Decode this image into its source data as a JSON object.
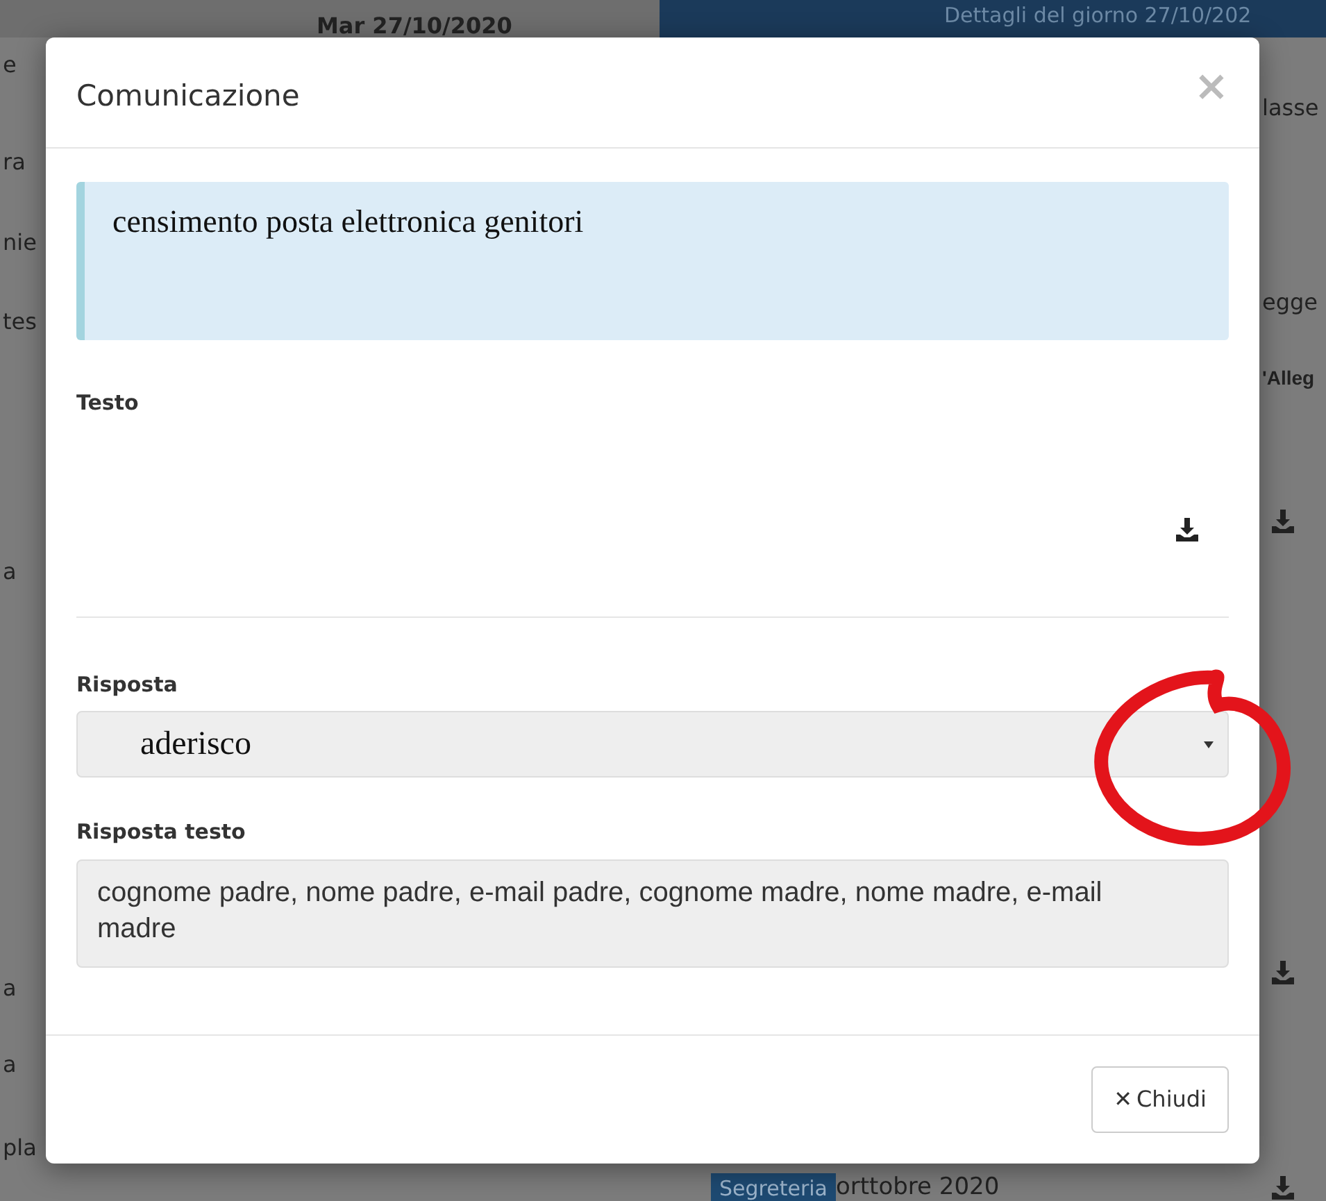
{
  "background": {
    "header_date": "Mar 27/10/2020",
    "details_bar": "Dettagli del giorno 27/10/202",
    "left_fragments": [
      "e",
      "ra",
      "nie",
      "tes",
      "a",
      "a",
      "a",
      "pla"
    ],
    "right_fragments": [
      "lasse",
      "egge",
      "'Alleg"
    ],
    "footer_badge": "Segreteria",
    "footer_text": "orttobre 2020"
  },
  "modal": {
    "title": "Comunicazione",
    "close": "×",
    "subject": "censimento posta elettronica genitori",
    "text_label": "Testo",
    "response_label": "Risposta",
    "response_value": "aderisco",
    "response_text_label": "Risposta testo",
    "response_text": "cognome padre, nome padre, e-mail padre, cognome madre, nome madre, e-mail madre",
    "close_button": {
      "icon": "✕",
      "label": "Chiudi"
    }
  }
}
